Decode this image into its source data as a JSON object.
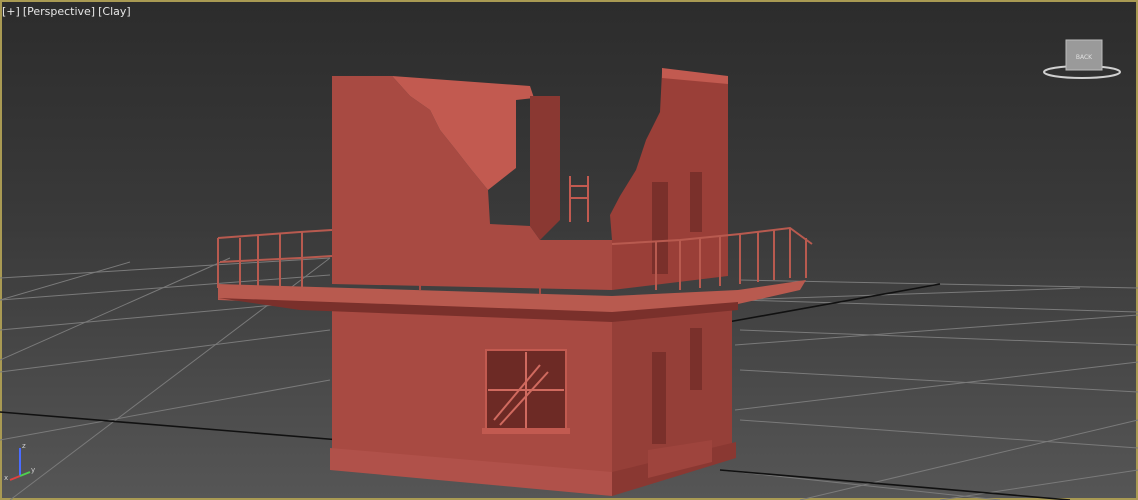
{
  "viewport": {
    "labels": [
      "[+]",
      "[Perspective]",
      "[Clay]"
    ],
    "viewcube_face": "BACK",
    "axis": {
      "x": "x",
      "y": "y",
      "z": "z"
    }
  },
  "colors": {
    "model": "#a84a42",
    "model_dark": "#7a302b",
    "model_light": "#c25a50",
    "grid": "#7a7a7a",
    "grid_axis": "#101010",
    "viewport_border": "#a99a53"
  }
}
